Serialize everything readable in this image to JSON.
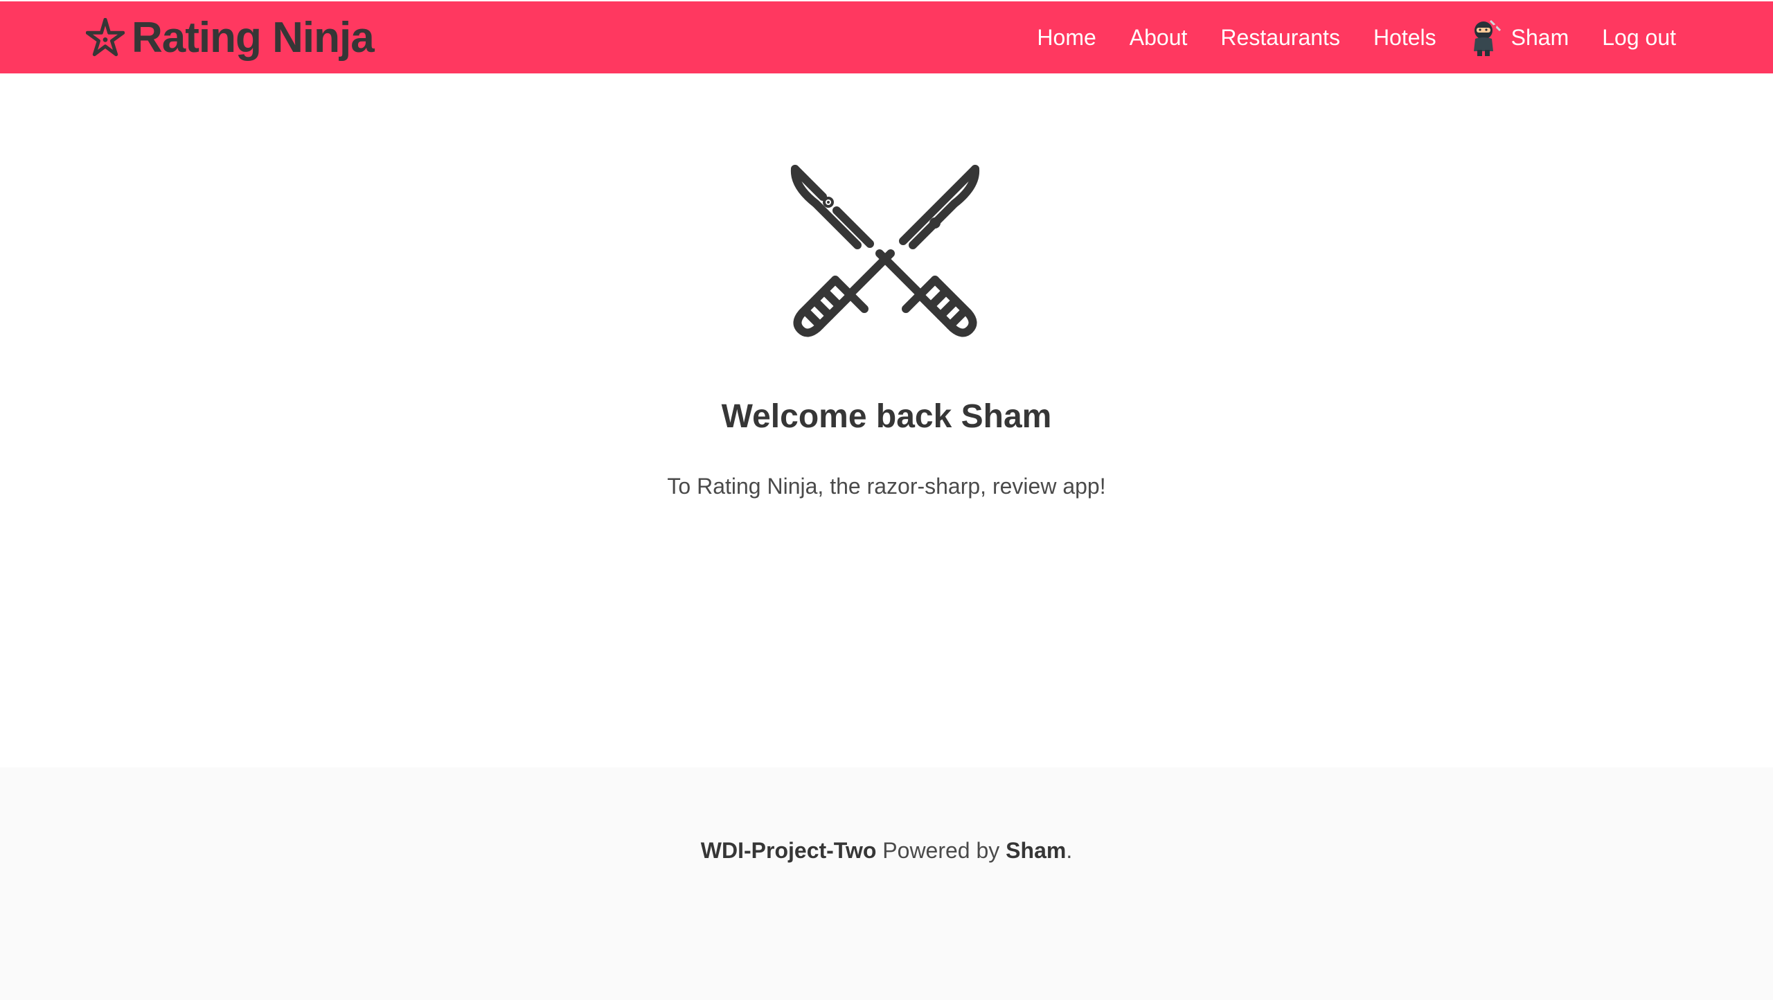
{
  "navbar": {
    "brand": {
      "icon": "shuriken-star-icon",
      "title": "Rating Ninja"
    },
    "links": [
      {
        "label": "Home"
      },
      {
        "label": "About"
      },
      {
        "label": "Restaurants"
      },
      {
        "label": "Hotels"
      },
      {
        "label": "Sham",
        "icon": "ninja-avatar-icon"
      },
      {
        "label": "Log out"
      }
    ]
  },
  "hero": {
    "icon": "crossed-katanas-icon",
    "title": "Welcome back Sham",
    "subtitle": "To Rating Ninja, the razor-sharp, review app!"
  },
  "footer": {
    "project": "WDI-Project-Two",
    "powered_by": "Powered by",
    "author": "Sham",
    "end": "."
  },
  "colors": {
    "navbar_bg": "#ff3860",
    "text_dark": "#363636",
    "footer_bg": "#fafafa"
  }
}
